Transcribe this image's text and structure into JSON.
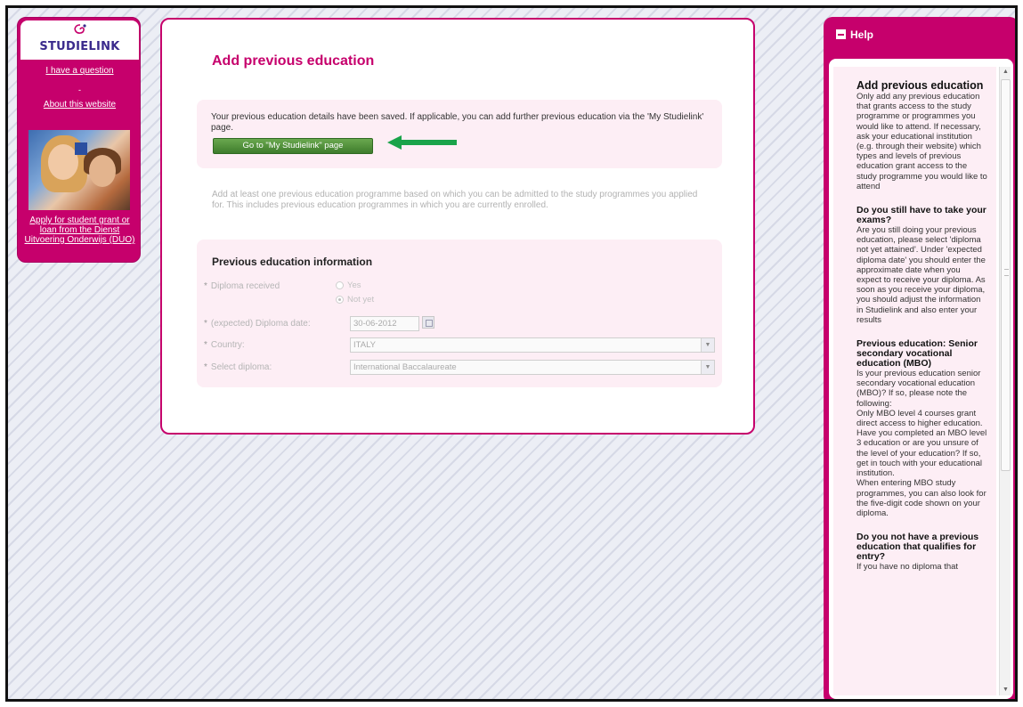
{
  "sidebar": {
    "logo_text": "STUDIELINK",
    "link_question": "I have a question",
    "separator": "-",
    "link_about": "About this website",
    "link_grant": "Apply for student grant or loan from the Dienst Uitvoering Onderwijs (DUO)"
  },
  "main": {
    "title": "Add previous education",
    "notice": "Your previous education details have been saved. If applicable, you can add further previous education via the 'My Studielink' page.",
    "go_button": "Go to \"My Studielink\" page",
    "intro": "Add at least one previous education programme based on which you can be admitted to the study programmes you applied for. This includes previous education programmes in which you are currently enrolled.",
    "form": {
      "title": "Previous education information",
      "required_mark": "*",
      "diploma_received_label": "Diploma received",
      "radio_yes": "Yes",
      "radio_not_yet": "Not yet",
      "radio_selected": "Not yet",
      "diploma_date_label": "(expected) Diploma date:",
      "diploma_date_value": "30-06-2012",
      "country_label": "Country:",
      "country_value": "ITALY",
      "diploma_label": "Select diploma:",
      "diploma_value": "International Baccalaureate"
    }
  },
  "help": {
    "header": "Help",
    "sections": [
      {
        "title": "Add previous education",
        "text": "Only add any previous education that grants access to the study programme or programmes you would like to attend. If necessary, ask your educational institution (e.g. through their website) which types and levels of previous education grant access to the study programme you would like to attend"
      },
      {
        "title": "Do you still have to take your exams?",
        "text": "Are you still doing your previous education, please select 'diploma not yet attained'. Under 'expected diploma date' you should enter the approximate date when you expect to receive your diploma. As soon as you receive your diploma, you should adjust the information in Studielink and also enter your results"
      },
      {
        "title": "Previous education: Senior secondary vocational education (MBO)",
        "text": "Is your previous education senior secondary vocational education (MBO)? If so, please note the following:",
        "text2": "Only MBO level 4 courses grant direct access to higher education. Have you completed an MBO level 3 education or are you unsure of the level of your education? If so, get in touch with your educational institution.",
        "text3": "When entering MBO study programmes, you can also look for the five-digit code shown on your diploma."
      },
      {
        "title": "Do you not have a previous education that qualifies for entry?",
        "text": "If you have no diploma that"
      }
    ]
  },
  "colors": {
    "brand": "#c6006c",
    "button_green": "#4a8a35",
    "arrow_green": "#1aa34a"
  }
}
